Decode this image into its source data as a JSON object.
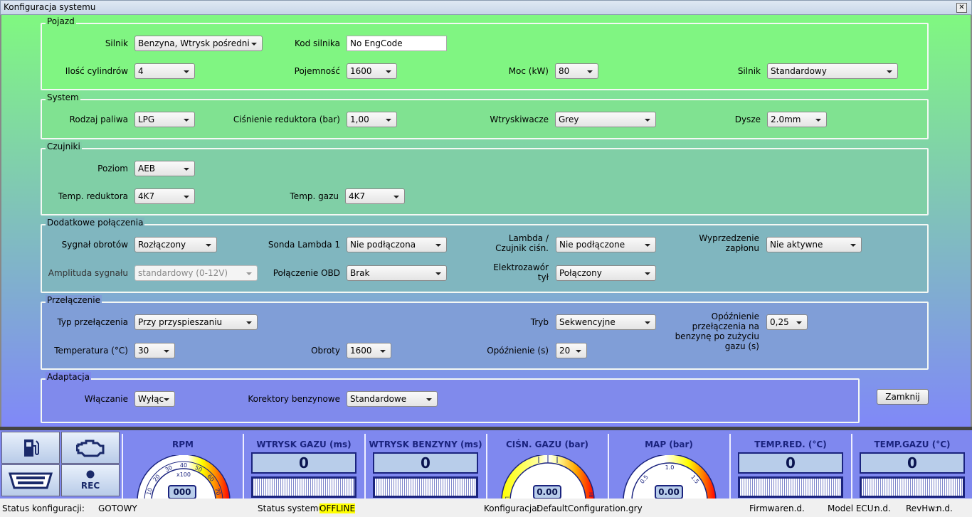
{
  "window": {
    "title": "Konfiguracja systemu",
    "close": "✕"
  },
  "groups": {
    "pojazd": {
      "title": "Pojazd",
      "silnik_label": "Silnik",
      "silnik": "Benzyna, Wtrysk pośredni",
      "kod_label": "Kod silnika",
      "kod": "No EngCode",
      "cyl_label": "Ilość cylindrów",
      "cyl": "4",
      "poj_label": "Pojemność",
      "poj": "1600",
      "moc_label": "Moc (kW)",
      "moc": "80",
      "silnik2_label": "Silnik",
      "silnik2": "Standardowy"
    },
    "system": {
      "title": "System",
      "paliwo_label": "Rodzaj paliwa",
      "paliwo": "LPG",
      "cisn_label": "Ciśnienie reduktora (bar)",
      "cisn": "1,00",
      "wtr_label": "Wtryskiwacze",
      "wtr": "Grey",
      "dysze_label": "Dysze",
      "dysze": "2.0mm"
    },
    "czujniki": {
      "title": "Czujniki",
      "poziom_label": "Poziom",
      "poziom": "AEB",
      "tred_label": "Temp. reduktora",
      "tred": "4K7",
      "tgaz_label": "Temp. gazu",
      "tgaz": "4K7"
    },
    "dodatkowe": {
      "title": "Dodatkowe połączenia",
      "obroty_label": "Sygnał obrotów",
      "obroty": "Rozłączony",
      "sonda_label": "Sonda Lambda 1",
      "sonda": "Nie podłączona",
      "lambda_label1": "Lambda /",
      "lambda_label2": "Czujnik ciśn.",
      "lambda": "Nie podłączone",
      "wyp_label1": "Wyprzedzenie",
      "wyp_label2": "zapłonu",
      "wyp": "Nie aktywne",
      "ampl_label": "Amplituda sygnału",
      "ampl": "standardowy (0-12V)",
      "obd_label": "Połączenie OBD",
      "obd": "Brak",
      "elektro_label1": "Elektrozawór",
      "elektro_label2": "tył",
      "elektro": "Połączony"
    },
    "przelaczenie": {
      "title": "Przełączenie",
      "typ_label": "Typ przełączenia",
      "typ": "Przy przyspieszaniu",
      "tryb_label": "Tryb",
      "tryb": "Sekwencyjne",
      "opoz2_label1": "Opóźnienie",
      "opoz2_label2": "przełączenia na",
      "opoz2_label3": "benzynę po zużyciu",
      "opoz2_label4": "gazu (s)",
      "opoz2": "0,25",
      "temp_label": "Temperatura (°C)",
      "temp": "30",
      "obr_label": "Obroty",
      "obr": "1600",
      "opoz_label": "Opóźnienie (s)",
      "opoz": "20"
    },
    "adaptacja": {
      "title": "Adaptacja",
      "wl_label": "Włączanie",
      "wl": "Wyłąc",
      "kor_label": "Korektory benzynowe",
      "kor": "Standardowe"
    }
  },
  "close_button": "Zamknij",
  "quick_buttons": {
    "rec": "REC",
    "icons": [
      "fuel-pump-icon",
      "check-engine-icon",
      "obd-connector-icon",
      "record-icon"
    ]
  },
  "gauges": {
    "rpm": {
      "title": "RPM",
      "unit": "x100",
      "value": "000",
      "ticks": [
        "10",
        "20",
        "30",
        "40",
        "50",
        "60",
        "70"
      ]
    },
    "wtrysk_gazu": {
      "title": "WTRYSK GAZU (ms)",
      "value": "0"
    },
    "wtrysk_benz": {
      "title": "WTRYSK BENZYNY (ms)",
      "value": "0"
    },
    "cisn_gazu": {
      "title": "CIŚN. GAZU (bar)",
      "value": "0.00",
      "lo": "LO",
      "hi": "HI"
    },
    "map": {
      "title": "MAP (bar)",
      "value": "0.00",
      "ticks": [
        "0.5",
        "1.0",
        "1.5"
      ]
    },
    "temp_red": {
      "title": "TEMP.RED. (°C)",
      "value": "0"
    },
    "temp_gazu": {
      "title": "TEMP.GAZU (°C)",
      "value": "0"
    }
  },
  "status": {
    "config_label": "Status konfiguracji:",
    "config": "GOTOWY",
    "system_label": "Status systemu:",
    "system": "OFFLINE",
    "file_label": "Konfiguracja:",
    "file": "DefaultConfiguration.gry",
    "fw_label": "Firmware:",
    "fw": "n.d.",
    "ecu_label": "Model ECU:",
    "ecu": "n.d.",
    "rev_label": "RevHw:",
    "rev": "n.d.",
    "highlight_color": "#ffff00"
  }
}
